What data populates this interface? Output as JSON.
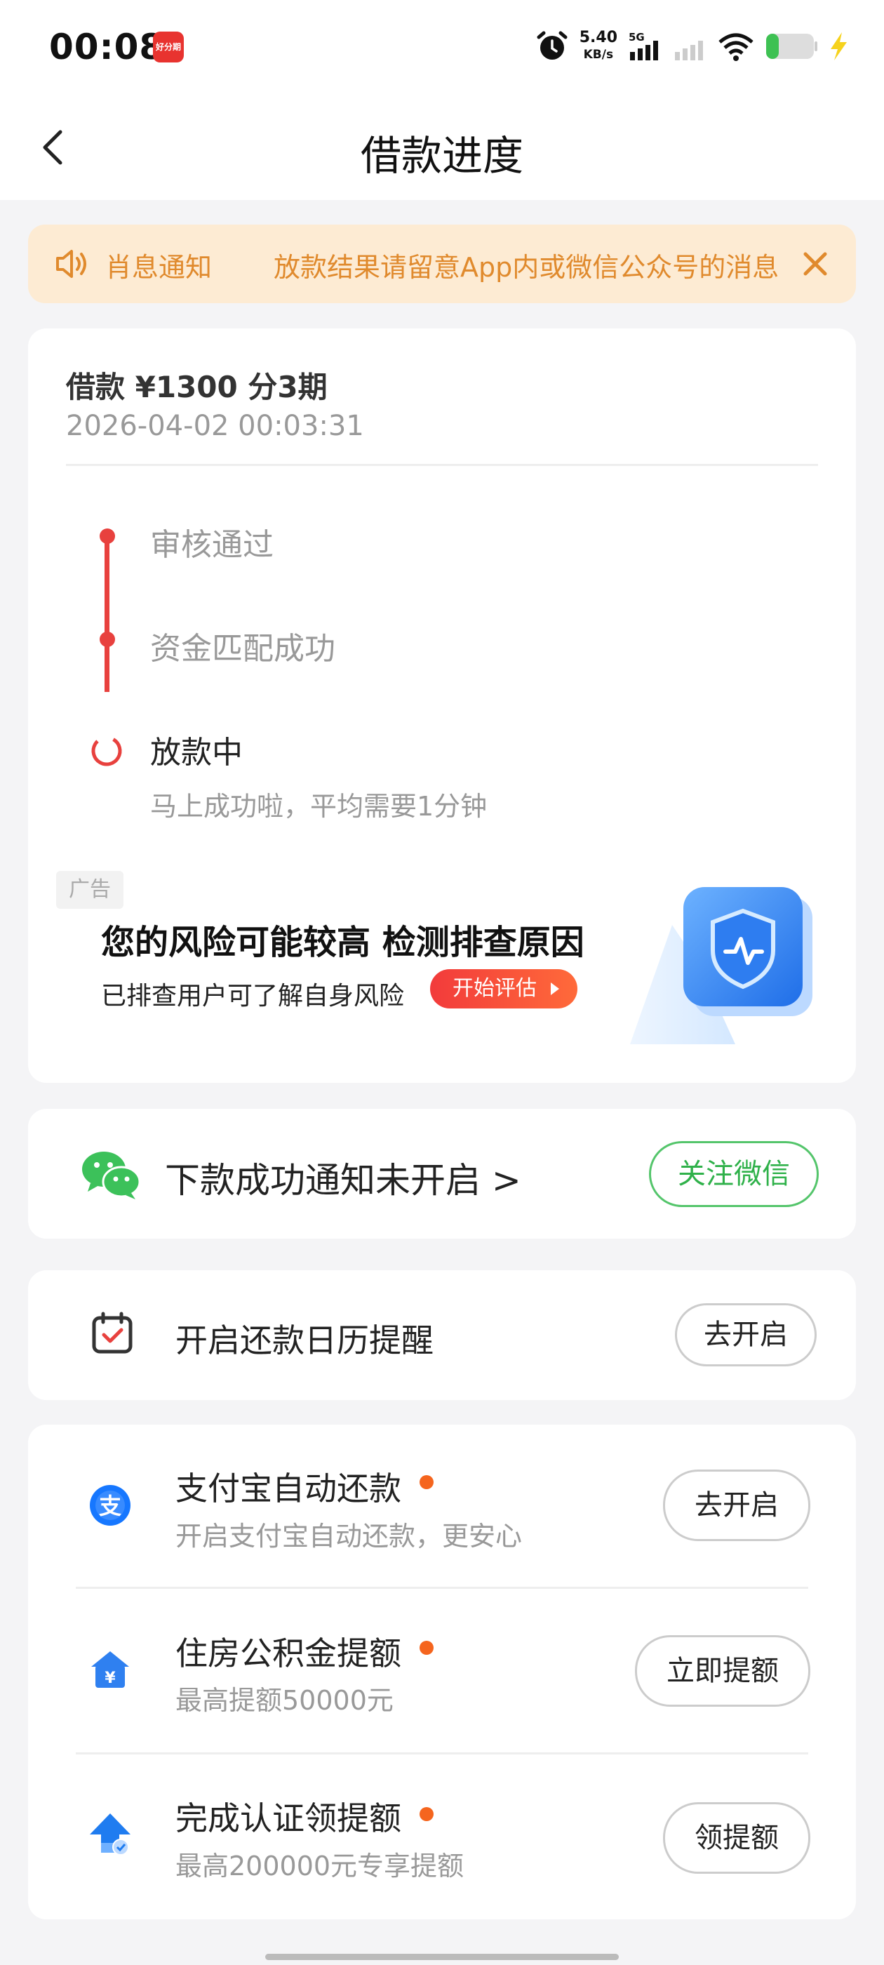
{
  "status_bar": {
    "time": "00:08",
    "app_badge": "好分期",
    "net_speed": "5.40",
    "net_unit": "KB/s",
    "network": "5G",
    "icons": [
      "alarm-icon",
      "signal-icon",
      "signal-weak-icon",
      "wifi-icon",
      "battery-icon",
      "charging-icon"
    ]
  },
  "nav": {
    "title": "借款进度",
    "back_icon": "chevron-left-icon"
  },
  "notice": {
    "label": "肖息通知",
    "message": "放款结果请留意App内或微信公众号的消息",
    "color": "#e08a2d",
    "background": "#fdebd3"
  },
  "loan": {
    "title": "借款 ¥1300  分3期",
    "time": "2026-04-02 00:03:31",
    "steps": [
      {
        "label": "审核通过",
        "status": "done"
      },
      {
        "label": "资金匹配成功",
        "status": "done"
      },
      {
        "label": "放款中",
        "status": "active",
        "sub": "马上成功啦，平均需要1分钟"
      }
    ],
    "accent": "#e8413e"
  },
  "ad": {
    "tag": "广告",
    "title": "您的风险可能较高 检测排查原因",
    "subtitle": "已排查用户可了解自身风险",
    "button": "开始评估"
  },
  "wechat": {
    "text": "下款成功通知未开启 >",
    "button": "关注微信"
  },
  "calendar": {
    "text": "开启还款日历提醒",
    "button": "去开启"
  },
  "list": [
    {
      "title": "支付宝自动还款",
      "sub": "开启支付宝自动还款，更安心",
      "button": "去开启",
      "icon": "alipay-icon"
    },
    {
      "title": "住房公积金提额",
      "sub": "最高提额50000元",
      "button": "立即提额",
      "icon": "housing-fund-icon"
    },
    {
      "title": "完成认证领提额",
      "sub": "最高200000元专享提额",
      "button": "领提额",
      "icon": "verify-upgrade-icon"
    }
  ]
}
